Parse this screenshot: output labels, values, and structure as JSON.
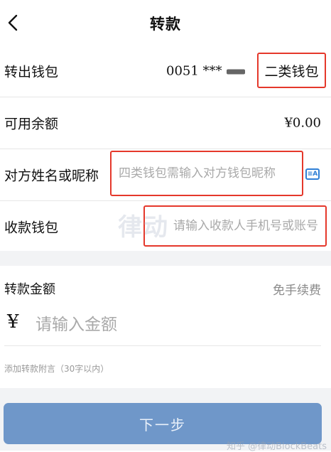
{
  "nav": {
    "title": "转款",
    "back_icon": "chevron-left-icon"
  },
  "rows": {
    "from_wallet": {
      "label": "转出钱包",
      "wallet_number": "0051 ***",
      "wallet_type": "二类钱包"
    },
    "balance": {
      "label": "可用余额",
      "value": "¥0.00"
    },
    "payee_name": {
      "label": "对方姓名或昵称",
      "placeholder": "四类钱包需输入对方钱包昵称",
      "icon": "contact-card-icon",
      "icon_text": "≡A"
    },
    "payee_wallet": {
      "label": "收款钱包",
      "placeholder": "请输入收款人手机号或账号"
    }
  },
  "amount": {
    "label": "转款金额",
    "fee_label": "免手续费",
    "currency": "¥",
    "placeholder": "请输入金额",
    "remark": "添加转款附言（30字以内）"
  },
  "next_button": {
    "label": "下一步"
  },
  "watermark": {
    "text": "律动"
  },
  "credit": {
    "text": "知乎 @律动BlockBeats"
  },
  "colors": {
    "highlight_border": "#e5382b",
    "button_bg": "#6f97c9",
    "icon_blue": "#2f7fd6",
    "section_gap": "#f2f3f5"
  }
}
